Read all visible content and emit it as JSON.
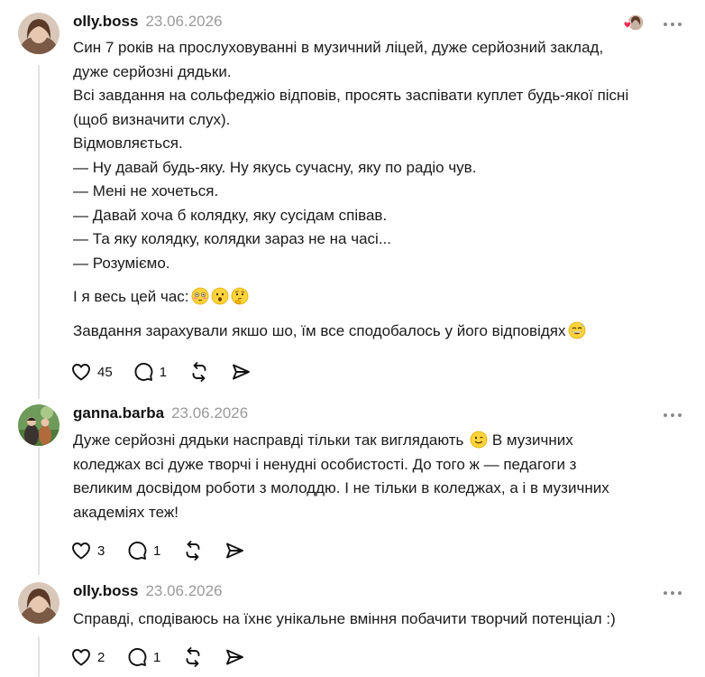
{
  "thread": [
    {
      "username": "olly.boss",
      "date": "23.06.2026",
      "lines": [
        "Син 7 років на прослуховуванні в музичний ліцей, дуже серйозний заклад,",
        "дуже серйозні дядьки.",
        "Всі завдання на сольфеджіо відповів, просять заспівати куплет будь-якої пісні",
        "(щоб визначити слух).",
        "Відмовляється.",
        "— Ну давай будь-яку. Ну якусь сучасну, яку по радіо чув.",
        "— Мені не хочеться.",
        "— Давай хоча б колядку, яку сусідам співав.",
        "— Та яку колядку, колядки зараз не на часі...",
        "— Розуміємо."
      ],
      "line_with_emoji_1": "І я весь цей час:",
      "line_with_emoji_2": "Завдання зарахували якшо шо, їм все сподобалось у його відповідях",
      "emojis_1": [
        "flushed-face",
        "hushed-face",
        "thinking-face"
      ],
      "emojis_2": [
        "grinning-sweat-face"
      ],
      "likes": "45",
      "replies": "1"
    },
    {
      "username": "ganna.barba",
      "date": "23.06.2026",
      "lines": [
        "Дуже серйозні дядьки насправді тільки так виглядають",
        "коледжах всі дуже творчі і ненудні особистості. До того ж — педагоги з",
        "великим досвідом роботи з молоддю. І не тільки в коледжах, а і в музичних",
        "академіях теж!"
      ],
      "line1_after_emoji": "В музичних",
      "emoji": "winking-face",
      "likes": "3",
      "replies": "1"
    },
    {
      "username": "olly.boss",
      "date": "23.06.2026",
      "lines": [
        "Справді, сподіваюсь на їхнє унікальне вміння побачити творчий потенціал :)"
      ],
      "likes": "2",
      "replies": "1"
    }
  ],
  "colors": {
    "like_heart": "#ff2b55",
    "muted": "#9a9a9a",
    "thread_line": "#e2e2e2"
  }
}
